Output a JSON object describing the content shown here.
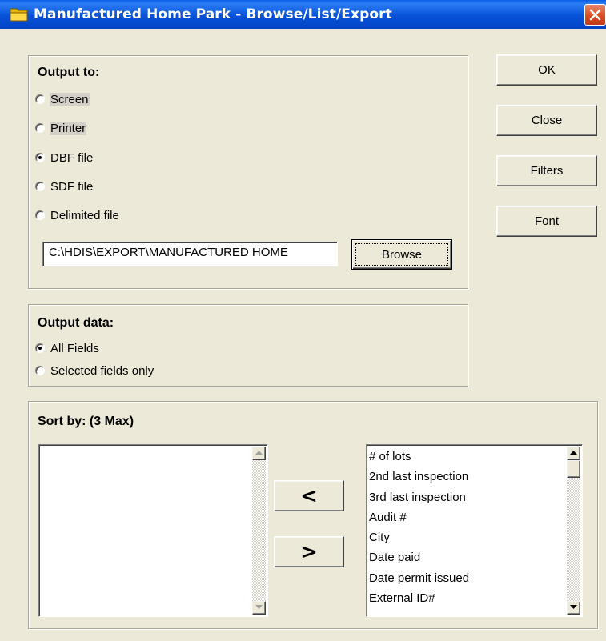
{
  "window": {
    "title": "Manufactured Home Park - Browse/List/Export"
  },
  "output_to": {
    "label": "Output to:",
    "options": [
      {
        "label": "Screen",
        "selected": false
      },
      {
        "label": "Printer",
        "selected": false
      },
      {
        "label": "DBF file",
        "selected": true
      },
      {
        "label": "SDF file",
        "selected": false
      },
      {
        "label": "Delimited file",
        "selected": false
      }
    ],
    "path_value": "C:\\HDIS\\EXPORT\\MANUFACTURED HOME",
    "browse_label": "Browse"
  },
  "output_data": {
    "label": "Output data:",
    "options": [
      {
        "label": "All Fields",
        "selected": true
      },
      {
        "label": "Selected fields only",
        "selected": false
      }
    ]
  },
  "sort_by": {
    "label": "Sort by: (3 Max)",
    "selected_fields": [],
    "add_label": "<",
    "remove_label": ">",
    "available_fields": [
      "# of lots",
      "2nd last inspection",
      "3rd last inspection",
      "Audit #",
      "City",
      "Date paid",
      "Date permit issued",
      "External ID#"
    ]
  },
  "buttons": {
    "ok": "OK",
    "close": "Close",
    "filters": "Filters",
    "font": "Font"
  }
}
